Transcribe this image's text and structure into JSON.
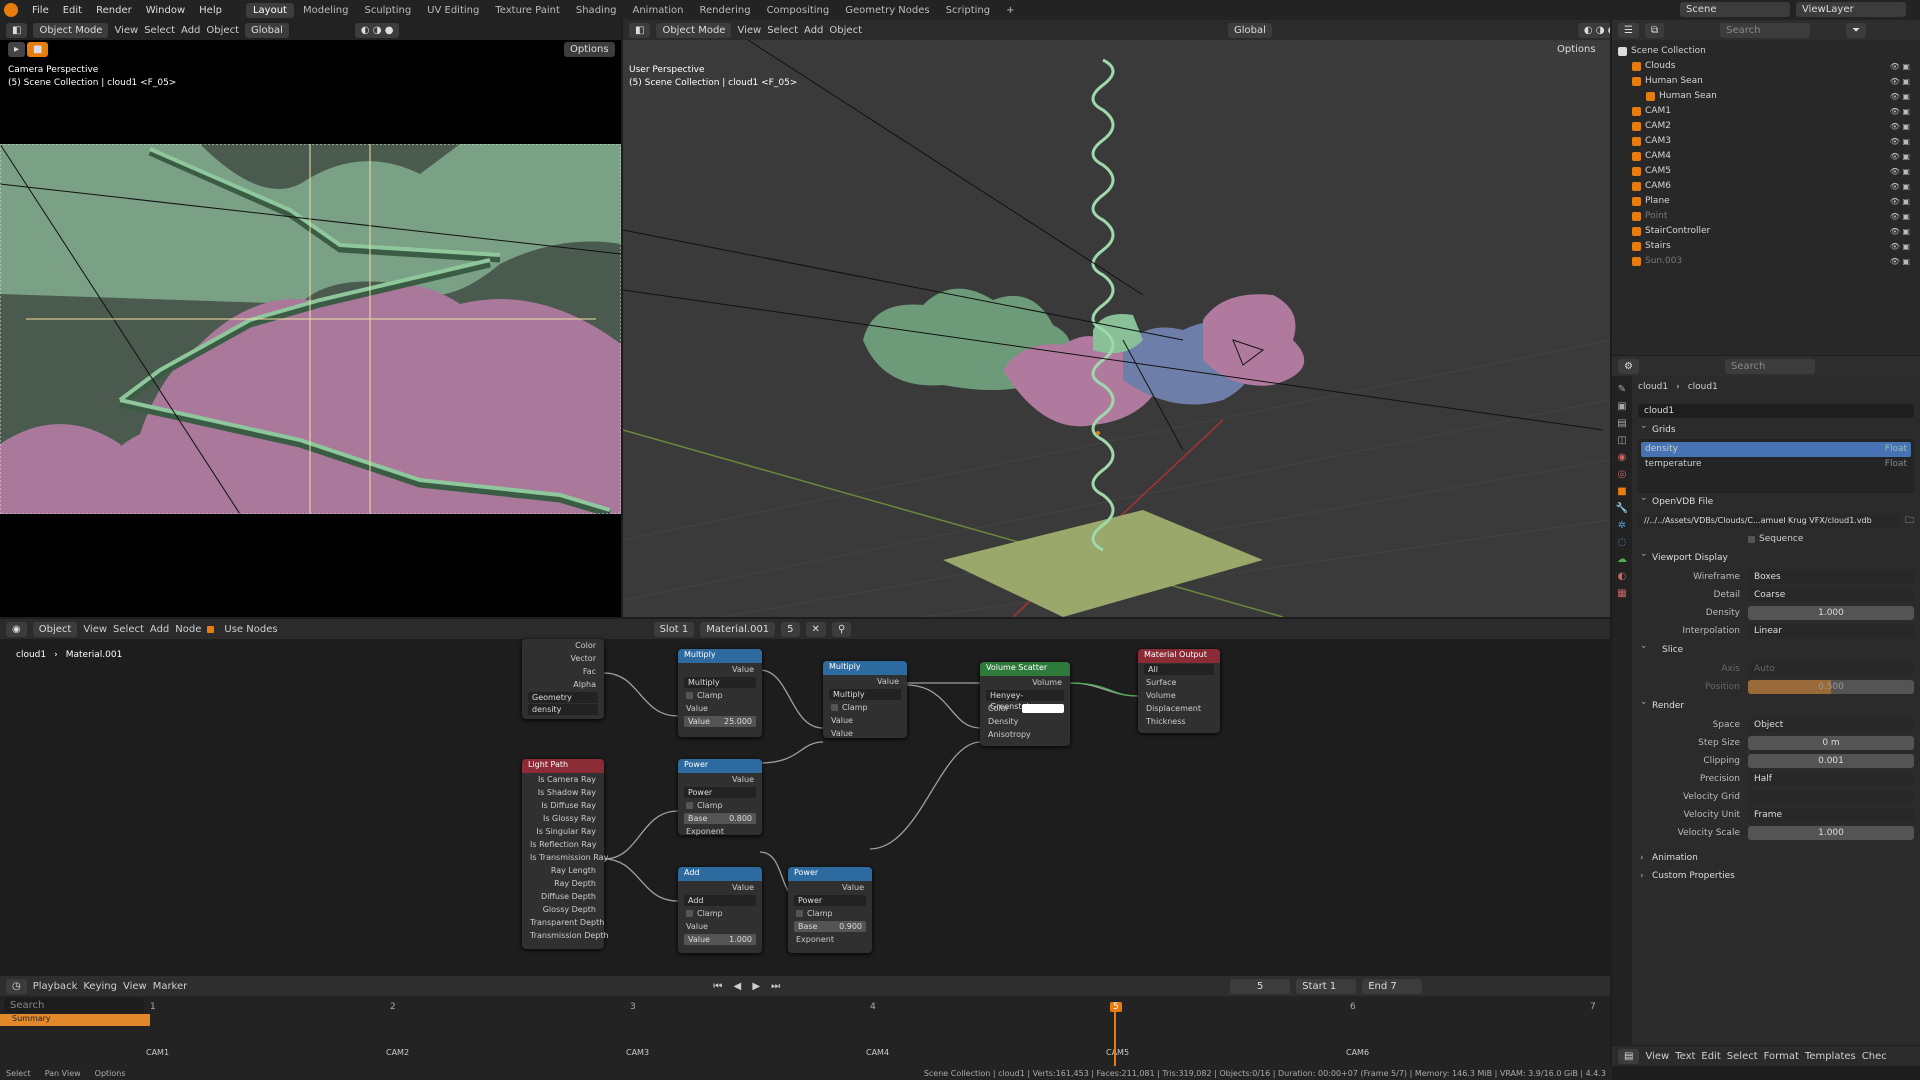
{
  "menu": [
    "File",
    "Edit",
    "Render",
    "Window",
    "Help"
  ],
  "workspaces": [
    "Layout",
    "Modeling",
    "Sculpting",
    "UV Editing",
    "Texture Paint",
    "Shading",
    "Animation",
    "Rendering",
    "Compositing",
    "Geometry Nodes",
    "Scripting"
  ],
  "top_right": {
    "scene": "Scene",
    "view_layer": "ViewLayer"
  },
  "vp_left": {
    "mode": "Object Mode",
    "menus": [
      "View",
      "Select",
      "Add",
      "Object"
    ],
    "transform": "Global",
    "options": "Options",
    "perspective": "Camera Perspective",
    "collection": "(5) Scene Collection | cloud1 <F_05>"
  },
  "vp_right": {
    "mode": "Object Mode",
    "menus": [
      "View",
      "Select",
      "Add",
      "Object"
    ],
    "transform": "Global",
    "options": "Options",
    "perspective": "User Perspective",
    "collection": "(5) Scene Collection | cloud1 <F_05>"
  },
  "node_editor": {
    "mode": "Object",
    "menus": [
      "View",
      "Select",
      "Add",
      "Node"
    ],
    "use_nodes": "Use Nodes",
    "slot": "Slot 1",
    "material": "Material.001",
    "users": "5",
    "breadcrumb_obj": "cloud1",
    "breadcrumb_mat": "Material.001",
    "attr": {
      "outputs": [
        "Color",
        "Vector",
        "Fac",
        "Alpha"
      ],
      "type": "Geometry",
      "name": "density"
    },
    "multiply1": {
      "title": "Multiply",
      "out": "Value",
      "op": "Multiply",
      "clamp": "Clamp",
      "in": "Value",
      "val_label": "Value",
      "val": "25.000"
    },
    "multiply2": {
      "title": "Multiply",
      "out": "Value",
      "op": "Multiply",
      "clamp": "Clamp",
      "in1": "Value",
      "in2": "Value"
    },
    "scatter": {
      "title": "Volume Scatter",
      "out": "Volume",
      "phase": "Henyey-Greenstein",
      "color": "Color",
      "density": "Density",
      "aniso": "Anisotropy"
    },
    "output": {
      "title": "Material Output",
      "target": "All",
      "surface": "Surface",
      "volume": "Volume",
      "displacement": "Displacement",
      "thickness": "Thickness"
    },
    "lightpath": {
      "title": "Light Path",
      "outputs": [
        "Is Camera Ray",
        "Is Shadow Ray",
        "Is Diffuse Ray",
        "Is Glossy Ray",
        "Is Singular Ray",
        "Is Reflection Ray",
        "Is Transmission Ray",
        "Ray Length",
        "Ray Depth",
        "Diffuse Depth",
        "Glossy Depth",
        "Transparent Depth",
        "Transmission Depth"
      ]
    },
    "power1": {
      "title": "Power",
      "out": "Value",
      "op": "Power",
      "clamp": "Clamp",
      "base_label": "Base",
      "base": "0.800",
      "exp": "Exponent"
    },
    "add": {
      "title": "Add",
      "out": "Value",
      "op": "Add",
      "clamp": "Clamp",
      "in": "Value",
      "val_label": "Value",
      "val": "1.000"
    },
    "power2": {
      "title": "Power",
      "out": "Value",
      "op": "Power",
      "clamp": "Clamp",
      "base_label": "Base",
      "base": "0.900",
      "exp": "Exponent"
    }
  },
  "outliner": {
    "search": "Search",
    "root": "Scene Collection",
    "items": [
      {
        "name": "Clouds",
        "color": "#d5d5d5"
      },
      {
        "name": "Human Sean",
        "color": "#d5d5d5"
      },
      {
        "name": "Human Sean",
        "color": "#d5d5d5"
      },
      {
        "name": "CAM1",
        "color": "#d5d5d5"
      },
      {
        "name": "CAM2",
        "color": "#d5d5d5"
      },
      {
        "name": "CAM3",
        "color": "#d5d5d5"
      },
      {
        "name": "CAM4",
        "color": "#d5d5d5"
      },
      {
        "name": "CAM5",
        "color": "#d5d5d5"
      },
      {
        "name": "CAM6",
        "color": "#d5d5d5"
      },
      {
        "name": "Plane",
        "color": "#d5d5d5"
      },
      {
        "name": "Point",
        "color": "#777"
      },
      {
        "name": "StairController",
        "color": "#d5d5d5"
      },
      {
        "name": "Stairs",
        "color": "#d5d5d5"
      },
      {
        "name": "Sun.003",
        "color": "#777"
      }
    ]
  },
  "props": {
    "search": "Search",
    "obj": "cloud1",
    "data": "cloud1",
    "name": "cloud1",
    "grids_title": "Grids",
    "grids": [
      {
        "name": "density",
        "type": "Float"
      },
      {
        "name": "temperature",
        "type": "Float"
      }
    ],
    "openvdb_title": "OpenVDB File",
    "file": "//../../Assets/VDBs/Clouds/C...amuel Krug VFX/cloud1.vdb",
    "sequence": "Sequence",
    "vd_title": "Viewport Display",
    "wireframe_l": "Wireframe",
    "wireframe": "Boxes",
    "detail_l": "Detail",
    "detail": "Coarse",
    "density_l": "Density",
    "density": "1.000",
    "interp_l": "Interpolation",
    "interp": "Linear",
    "slice_title": "Slice",
    "axis_l": "Axis",
    "axis": "Auto",
    "position_l": "Position",
    "position": "0.500",
    "render_title": "Render",
    "space_l": "Space",
    "space": "Object",
    "step_l": "Step Size",
    "step": "0 m",
    "clip_l": "Clipping",
    "clip": "0.001",
    "prec_l": "Precision",
    "prec": "Half",
    "vgrid_l": "Velocity Grid",
    "vgrid": "",
    "vunit_l": "Velocity Unit",
    "vunit": "Frame",
    "vscale_l": "Velocity Scale",
    "vscale": "1.000",
    "anim": "Animation",
    "custom": "Custom Properties"
  },
  "timeline": {
    "menus": [
      "Playback",
      "Keying",
      "View",
      "Marker"
    ],
    "frame": "5",
    "start_l": "Start",
    "start": "1",
    "end_l": "End",
    "end": "7",
    "search": "Search",
    "summary": "Summary",
    "ticks": [
      "1",
      "2",
      "3",
      "4",
      "5",
      "6",
      "7"
    ],
    "markers": [
      "CAM1",
      "CAM2",
      "CAM3",
      "CAM4",
      "CAM5",
      "CAM6"
    ]
  },
  "text_editor": {
    "menus": [
      "View",
      "Text",
      "Edit",
      "Select",
      "Format",
      "Templates"
    ],
    "check": "Chec"
  },
  "status": {
    "select": "Select",
    "pan": "Pan View",
    "options": "Options",
    "info": "Scene Collection | cloud1 | Verts:161,453 | Faces:211,081 | Tris:319,082 | Objects:0/16 | Duration: 00:00+07 (Frame 5/7) | Memory: 146.3 MiB | VRAM: 3.9/16.0 GiB | 4.4.3"
  }
}
